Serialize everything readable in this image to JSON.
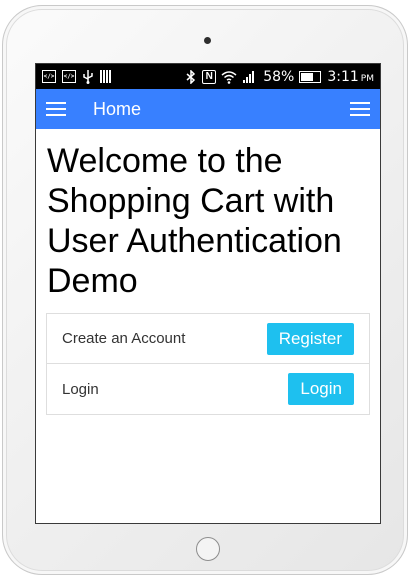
{
  "status_bar": {
    "icons_left": [
      "code-icon",
      "code-icon",
      "usb-icon",
      "barcode-icon"
    ],
    "icons_right": [
      "bluetooth-icon",
      "nfc-icon",
      "wifi-icon",
      "signal-icon"
    ],
    "nfc_letter": "N",
    "battery_percent": "58%",
    "battery_level": 0.58,
    "time": "3:11",
    "ampm": "PM"
  },
  "app_bar": {
    "title": "Home",
    "accent_color": "#3880ff"
  },
  "main": {
    "heading": "Welcome to the Shopping Cart with User Authentication Demo",
    "list": [
      {
        "label": "Create an Account",
        "button": "Register"
      },
      {
        "label": "Login",
        "button": "Login"
      }
    ],
    "button_color": "#1ec0ef"
  }
}
